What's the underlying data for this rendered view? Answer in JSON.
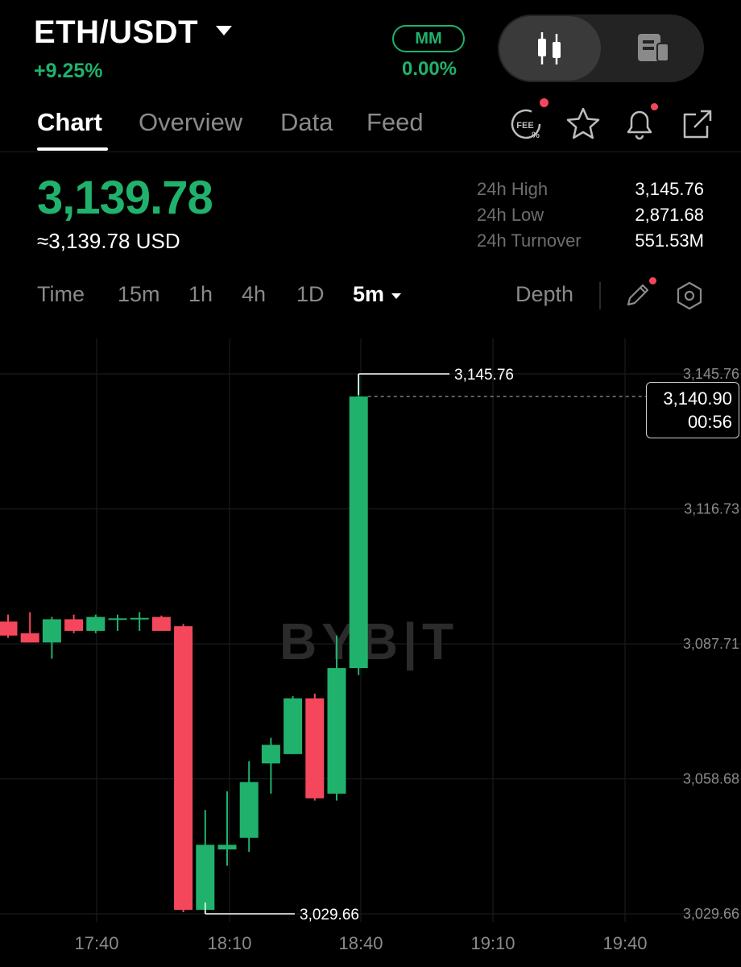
{
  "header": {
    "pair": "ETH/USDT",
    "change": "+9.25%",
    "mm_label": "MM",
    "mm_value": "0.00%",
    "view_toggle": [
      "candlestick-icon",
      "document-list-icon"
    ]
  },
  "tabs": [
    {
      "label": "Chart",
      "active": true
    },
    {
      "label": "Overview",
      "active": false
    },
    {
      "label": "Data",
      "active": false
    },
    {
      "label": "Feed",
      "active": false
    }
  ],
  "header_icons": {
    "fee_label": "FEE",
    "icons": [
      "fee-icon",
      "star-icon",
      "bell-icon",
      "share-icon"
    ]
  },
  "price": {
    "last": "3,139.78",
    "usd": "≈3,139.78 USD"
  },
  "stats": [
    {
      "label": "24h High",
      "value": "3,145.76"
    },
    {
      "label": "24h Low",
      "value": "2,871.68"
    },
    {
      "label": "24h Turnover",
      "value": "551.53M"
    }
  ],
  "timeframes": {
    "items": [
      "Time",
      "15m",
      "1h",
      "4h",
      "1D"
    ],
    "active": "5m",
    "depth": "Depth",
    "icons": [
      "pencil-icon",
      "settings-hexagon-icon"
    ]
  },
  "colors": {
    "up": "#20b26c",
    "down": "#f5475c",
    "background": "#000000"
  },
  "chart_data": {
    "type": "candlestick",
    "interval": "5m",
    "watermark": "BYB|T",
    "y_ticks": [
      "3,145.76",
      "3,116.73",
      "3,087.71",
      "3,058.68",
      "3,029.66"
    ],
    "y_tick_values": [
      3145.76,
      3116.73,
      3087.71,
      3058.68,
      3029.66
    ],
    "x_ticks": [
      "17:40",
      "18:10",
      "18:40",
      "19:10",
      "19:40"
    ],
    "high_annotation": "3,145.76",
    "low_annotation": "3,029.66",
    "current_price": "3,140.90",
    "countdown": "00:56",
    "candles": [
      {
        "o": 3092.5,
        "h": 3094.0,
        "l": 3089.0,
        "c": 3089.5
      },
      {
        "o": 3090.0,
        "h": 3094.5,
        "l": 3088.0,
        "c": 3088.0
      },
      {
        "o": 3088.0,
        "h": 3093.5,
        "l": 3084.5,
        "c": 3093.0
      },
      {
        "o": 3093.0,
        "h": 3094.0,
        "l": 3090.0,
        "c": 3090.5
      },
      {
        "o": 3090.5,
        "h": 3094.0,
        "l": 3090.0,
        "c": 3093.5
      },
      {
        "o": 3093.0,
        "h": 3094.0,
        "l": 3090.5,
        "c": 3093.2
      },
      {
        "o": 3093.0,
        "h": 3094.5,
        "l": 3090.5,
        "c": 3093.3
      },
      {
        "o": 3093.5,
        "h": 3093.8,
        "l": 3090.5,
        "c": 3090.5
      },
      {
        "o": 3091.5,
        "h": 3092.0,
        "l": 3030.0,
        "c": 3030.5
      },
      {
        "o": 3030.5,
        "h": 3052.0,
        "l": 3029.66,
        "c": 3044.5
      },
      {
        "o": 3043.5,
        "h": 3056.0,
        "l": 3040.0,
        "c": 3044.5
      },
      {
        "o": 3046.0,
        "h": 3062.5,
        "l": 3043.0,
        "c": 3058.0
      },
      {
        "o": 3062.0,
        "h": 3067.5,
        "l": 3055.5,
        "c": 3066.0
      },
      {
        "o": 3064.0,
        "h": 3076.5,
        "l": 3064.0,
        "c": 3076.0
      },
      {
        "o": 3076.0,
        "h": 3077.0,
        "l": 3054.0,
        "c": 3054.5
      },
      {
        "o": 3055.5,
        "h": 3089.5,
        "l": 3054.0,
        "c": 3082.5
      },
      {
        "o": 3082.5,
        "h": 3145.76,
        "l": 3081.0,
        "c": 3140.9
      }
    ]
  }
}
